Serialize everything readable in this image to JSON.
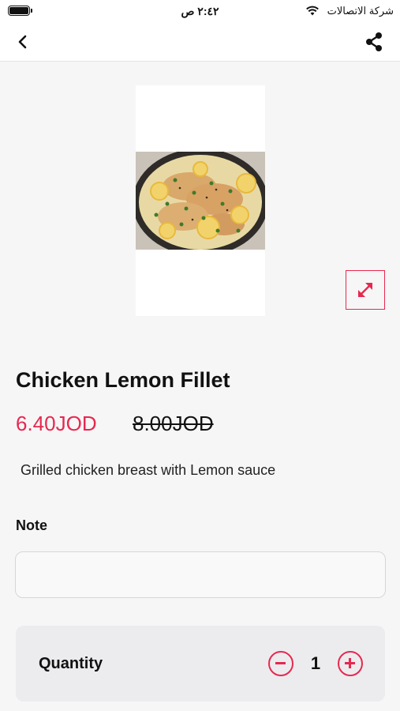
{
  "status_bar": {
    "time": "٢:٤٢ ص",
    "carrier": "شركة الاتصالات",
    "battery_level": 1.0,
    "icons": [
      "battery-icon",
      "wifi-icon"
    ]
  },
  "nav": {
    "icons": [
      "chevron-left-icon",
      "share-icon"
    ]
  },
  "product": {
    "image_alt": "Chicken Lemon Fillet dish",
    "expand_icon": "expand-arrows-icon",
    "title": "Chicken Lemon Fillet",
    "price": "6.40JOD",
    "original_price": "8.00JOD",
    "description": "Grilled chicken breast with Lemon sauce"
  },
  "note": {
    "label": "Note",
    "value": "",
    "placeholder": ""
  },
  "quantity": {
    "label": "Quantity",
    "value": "1",
    "icons": [
      "minus-circle-icon",
      "plus-circle-icon"
    ]
  },
  "colors": {
    "accent": "#e8284f",
    "background": "#f6f6f7",
    "card": "#ececef"
  }
}
